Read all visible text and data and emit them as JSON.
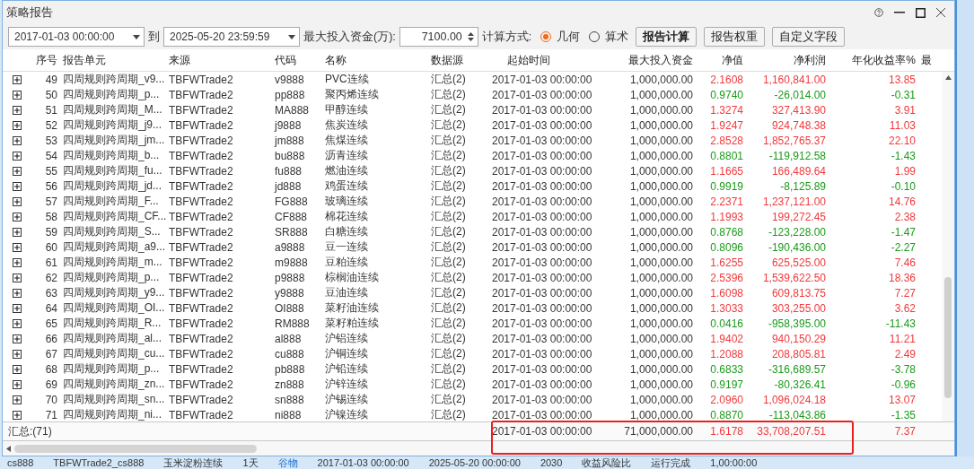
{
  "window": {
    "title": "策略报告"
  },
  "toolbar": {
    "start": "2017-01-03 00:00:00",
    "to_label": "到",
    "end": "2025-05-20 23:59:59",
    "capital_label": "最大投入资金(万):",
    "capital": "7100.00",
    "method_label": "计算方式:",
    "methods": [
      {
        "label": "几何",
        "selected": true
      },
      {
        "label": "算术",
        "selected": false
      }
    ],
    "buttons": [
      {
        "label": "报告计算",
        "primary": true
      },
      {
        "label": "报告权重",
        "primary": false
      },
      {
        "label": "自定义字段",
        "primary": false
      }
    ]
  },
  "table": {
    "columns": [
      "序号",
      "报告单元",
      "来源",
      "代码",
      "名称",
      "数据源",
      "起始时间",
      "最大投入资金",
      "净值",
      "净利润",
      "年化收益率%",
      "最"
    ],
    "rows": [
      {
        "no": "49",
        "unit": "四周规则跨周期_v9...",
        "source": "TBFWTrade2",
        "code": "v9888",
        "name": "PVC连续",
        "datasource": "汇总(2)",
        "start": "2017-01-03 00:00:00",
        "capital": "1,000,000.00",
        "nav": "2.1608",
        "profit": "1,160,841.00",
        "annual": "13.85",
        "positive": true
      },
      {
        "no": "50",
        "unit": "四周规则跨周期_p...",
        "source": "TBFWTrade2",
        "code": "pp888",
        "name": "聚丙烯连续",
        "datasource": "汇总(2)",
        "start": "2017-01-03 00:00:00",
        "capital": "1,000,000.00",
        "nav": "0.9740",
        "profit": "-26,014.00",
        "annual": "-0.31",
        "positive": false
      },
      {
        "no": "51",
        "unit": "四周规则跨周期_M...",
        "source": "TBFWTrade2",
        "code": "MA888",
        "name": "甲醇连续",
        "datasource": "汇总(2)",
        "start": "2017-01-03 00:00:00",
        "capital": "1,000,000.00",
        "nav": "1.3274",
        "profit": "327,413.90",
        "annual": "3.91",
        "positive": true
      },
      {
        "no": "52",
        "unit": "四周规则跨周期_j9...",
        "source": "TBFWTrade2",
        "code": "j9888",
        "name": "焦炭连续",
        "datasource": "汇总(2)",
        "start": "2017-01-03 00:00:00",
        "capital": "1,000,000.00",
        "nav": "1.9247",
        "profit": "924,748.38",
        "annual": "11.03",
        "positive": true
      },
      {
        "no": "53",
        "unit": "四周规则跨周期_jm...",
        "source": "TBFWTrade2",
        "code": "jm888",
        "name": "焦煤连续",
        "datasource": "汇总(2)",
        "start": "2017-01-03 00:00:00",
        "capital": "1,000,000.00",
        "nav": "2.8528",
        "profit": "1,852,765.37",
        "annual": "22.10",
        "positive": true
      },
      {
        "no": "54",
        "unit": "四周规则跨周期_b...",
        "source": "TBFWTrade2",
        "code": "bu888",
        "name": "沥青连续",
        "datasource": "汇总(2)",
        "start": "2017-01-03 00:00:00",
        "capital": "1,000,000.00",
        "nav": "0.8801",
        "profit": "-119,912.58",
        "annual": "-1.43",
        "positive": false
      },
      {
        "no": "55",
        "unit": "四周规则跨周期_fu...",
        "source": "TBFWTrade2",
        "code": "fu888",
        "name": "燃油连续",
        "datasource": "汇总(2)",
        "start": "2017-01-03 00:00:00",
        "capital": "1,000,000.00",
        "nav": "1.1665",
        "profit": "166,489.64",
        "annual": "1.99",
        "positive": true
      },
      {
        "no": "56",
        "unit": "四周规则跨周期_jd...",
        "source": "TBFWTrade2",
        "code": "jd888",
        "name": "鸡蛋连续",
        "datasource": "汇总(2)",
        "start": "2017-01-03 00:00:00",
        "capital": "1,000,000.00",
        "nav": "0.9919",
        "profit": "-8,125.89",
        "annual": "-0.10",
        "positive": false
      },
      {
        "no": "57",
        "unit": "四周规则跨周期_F...",
        "source": "TBFWTrade2",
        "code": "FG888",
        "name": "玻璃连续",
        "datasource": "汇总(2)",
        "start": "2017-01-03 00:00:00",
        "capital": "1,000,000.00",
        "nav": "2.2371",
        "profit": "1,237,121.00",
        "annual": "14.76",
        "positive": true
      },
      {
        "no": "58",
        "unit": "四周规则跨周期_CF...",
        "source": "TBFWTrade2",
        "code": "CF888",
        "name": "棉花连续",
        "datasource": "汇总(2)",
        "start": "2017-01-03 00:00:00",
        "capital": "1,000,000.00",
        "nav": "1.1993",
        "profit": "199,272.45",
        "annual": "2.38",
        "positive": true
      },
      {
        "no": "59",
        "unit": "四周规则跨周期_S...",
        "source": "TBFWTrade2",
        "code": "SR888",
        "name": "白糖连续",
        "datasource": "汇总(2)",
        "start": "2017-01-03 00:00:00",
        "capital": "1,000,000.00",
        "nav": "0.8768",
        "profit": "-123,228.00",
        "annual": "-1.47",
        "positive": false
      },
      {
        "no": "60",
        "unit": "四周规则跨周期_a9...",
        "source": "TBFWTrade2",
        "code": "a9888",
        "name": "豆一连续",
        "datasource": "汇总(2)",
        "start": "2017-01-03 00:00:00",
        "capital": "1,000,000.00",
        "nav": "0.8096",
        "profit": "-190,436.00",
        "annual": "-2.27",
        "positive": false
      },
      {
        "no": "61",
        "unit": "四周规则跨周期_m...",
        "source": "TBFWTrade2",
        "code": "m9888",
        "name": "豆粕连续",
        "datasource": "汇总(2)",
        "start": "2017-01-03 00:00:00",
        "capital": "1,000,000.00",
        "nav": "1.6255",
        "profit": "625,525.00",
        "annual": "7.46",
        "positive": true
      },
      {
        "no": "62",
        "unit": "四周规则跨周期_p...",
        "source": "TBFWTrade2",
        "code": "p9888",
        "name": "棕榈油连续",
        "datasource": "汇总(2)",
        "start": "2017-01-03 00:00:00",
        "capital": "1,000,000.00",
        "nav": "2.5396",
        "profit": "1,539,622.50",
        "annual": "18.36",
        "positive": true
      },
      {
        "no": "63",
        "unit": "四周规则跨周期_y9...",
        "source": "TBFWTrade2",
        "code": "y9888",
        "name": "豆油连续",
        "datasource": "汇总(2)",
        "start": "2017-01-03 00:00:00",
        "capital": "1,000,000.00",
        "nav": "1.6098",
        "profit": "609,813.75",
        "annual": "7.27",
        "positive": true
      },
      {
        "no": "64",
        "unit": "四周规则跨周期_OI...",
        "source": "TBFWTrade2",
        "code": "OI888",
        "name": "菜籽油连续",
        "datasource": "汇总(2)",
        "start": "2017-01-03 00:00:00",
        "capital": "1,000,000.00",
        "nav": "1.3033",
        "profit": "303,255.00",
        "annual": "3.62",
        "positive": true
      },
      {
        "no": "65",
        "unit": "四周规则跨周期_R...",
        "source": "TBFWTrade2",
        "code": "RM888",
        "name": "菜籽粕连续",
        "datasource": "汇总(2)",
        "start": "2017-01-03 00:00:00",
        "capital": "1,000,000.00",
        "nav": "0.0416",
        "profit": "-958,395.00",
        "annual": "-11.43",
        "positive": false
      },
      {
        "no": "66",
        "unit": "四周规则跨周期_al...",
        "source": "TBFWTrade2",
        "code": "al888",
        "name": "沪铝连续",
        "datasource": "汇总(2)",
        "start": "2017-01-03 00:00:00",
        "capital": "1,000,000.00",
        "nav": "1.9402",
        "profit": "940,150.29",
        "annual": "11.21",
        "positive": true
      },
      {
        "no": "67",
        "unit": "四周规则跨周期_cu...",
        "source": "TBFWTrade2",
        "code": "cu888",
        "name": "沪铜连续",
        "datasource": "汇总(2)",
        "start": "2017-01-03 00:00:00",
        "capital": "1,000,000.00",
        "nav": "1.2088",
        "profit": "208,805.81",
        "annual": "2.49",
        "positive": true
      },
      {
        "no": "68",
        "unit": "四周规则跨周期_p...",
        "source": "TBFWTrade2",
        "code": "pb888",
        "name": "沪铅连续",
        "datasource": "汇总(2)",
        "start": "2017-01-03 00:00:00",
        "capital": "1,000,000.00",
        "nav": "0.6833",
        "profit": "-316,689.57",
        "annual": "-3.78",
        "positive": false
      },
      {
        "no": "69",
        "unit": "四周规则跨周期_zn...",
        "source": "TBFWTrade2",
        "code": "zn888",
        "name": "沪锌连续",
        "datasource": "汇总(2)",
        "start": "2017-01-03 00:00:00",
        "capital": "1,000,000.00",
        "nav": "0.9197",
        "profit": "-80,326.41",
        "annual": "-0.96",
        "positive": false
      },
      {
        "no": "70",
        "unit": "四周规则跨周期_sn...",
        "source": "TBFWTrade2",
        "code": "sn888",
        "name": "沪锡连续",
        "datasource": "汇总(2)",
        "start": "2017-01-03 00:00:00",
        "capital": "1,000,000.00",
        "nav": "2.0960",
        "profit": "1,096,024.18",
        "annual": "13.07",
        "positive": true
      },
      {
        "no": "71",
        "unit": "四周规则跨周期_ni...",
        "source": "TBFWTrade2",
        "code": "ni888",
        "name": "沪镍连续",
        "datasource": "汇总(2)",
        "start": "2017-01-03 00:00:00",
        "capital": "1,000,000.00",
        "nav": "0.8870",
        "profit": "-113,043.86",
        "annual": "-1.35",
        "positive": false
      }
    ],
    "summary": {
      "label": "汇总:(71)",
      "start": "2017-01-03 00:00:00",
      "capital": "71,000,000.00",
      "nav": "1.6178",
      "profit": "33,708,207.51",
      "annual": "7.37",
      "positive": true
    }
  },
  "annotation": {
    "kind": "rectangle"
  },
  "background_row": [
    "cs888",
    "TBFWTrade2_cs888",
    "玉米淀粉连续",
    "1天",
    "谷物",
    "2017-01-03 00:00:00",
    "2025-05-20 00:00:00",
    "2030",
    "收益风险比",
    "运行完成",
    "1,00:00:00"
  ]
}
